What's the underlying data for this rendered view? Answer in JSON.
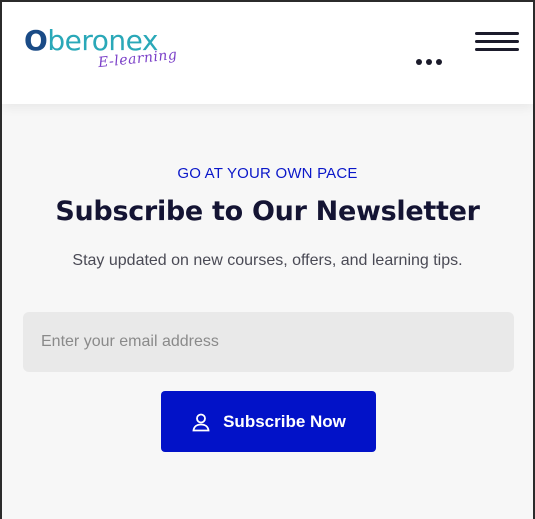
{
  "header": {
    "logo": {
      "first_letter": "O",
      "rest": "beronex",
      "tagline": "E-learning"
    },
    "more_icon": "more-dots-icon",
    "menu_icon": "hamburger-menu-icon"
  },
  "newsletter": {
    "eyebrow": "GO AT YOUR OWN PACE",
    "title": "Subscribe to Our Newsletter",
    "description": "Stay updated on new courses, offers, and learning tips.",
    "email_placeholder": "Enter your email address",
    "email_value": "",
    "button_label": "Subscribe Now",
    "button_icon": "user-icon"
  },
  "colors": {
    "accent": "#0212c8",
    "eyebrow": "#0a17c9",
    "title": "#141433",
    "logo_blue": "#1a4b86",
    "logo_teal": "#2aa8b8",
    "logo_purple": "#7a3fc8"
  }
}
